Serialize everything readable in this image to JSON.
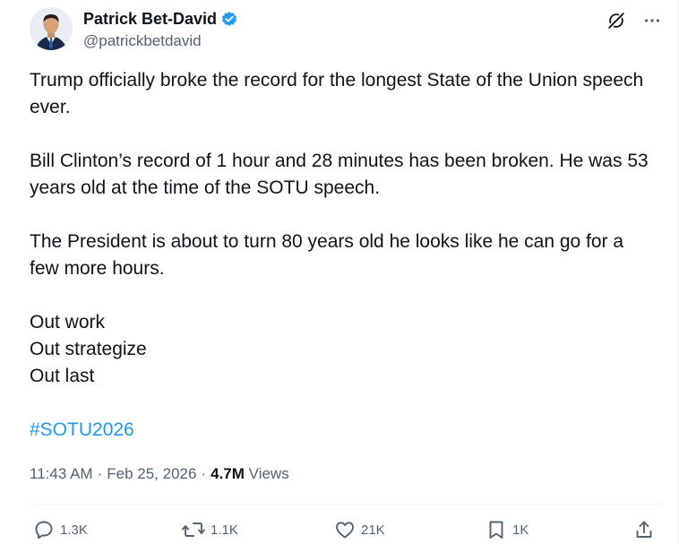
{
  "author": {
    "display_name": "Patrick Bet-David",
    "handle": "@patrickbetdavid",
    "verified": true
  },
  "header_icons": [
    "grok-icon",
    "more-icon"
  ],
  "post": {
    "paragraphs": [
      "Trump officially broke the record for the longest State of the Union speech ever.",
      "Bill Clinton’s record of 1 hour and 28 minutes has been broken.   He was 53 years old at the time of the SOTU speech.",
      "The President is about to turn 80 years old he looks like he can go for a few more hours."
    ],
    "lines": [
      "Out work",
      "Out strategize",
      "Out last"
    ],
    "hashtag": "#SOTU2026"
  },
  "meta": {
    "time": "11:43 AM",
    "sep1": "·",
    "date": "Feb 25, 2026",
    "sep2": "·",
    "views_count": "4.7M",
    "views_label": "Views"
  },
  "actions": {
    "replies": "1.3K",
    "reposts": "1.1K",
    "likes": "21K",
    "bookmarks": "1K"
  },
  "colors": {
    "accent": "#1d9bf0",
    "text": "#0f1419",
    "secondary": "#536471"
  }
}
